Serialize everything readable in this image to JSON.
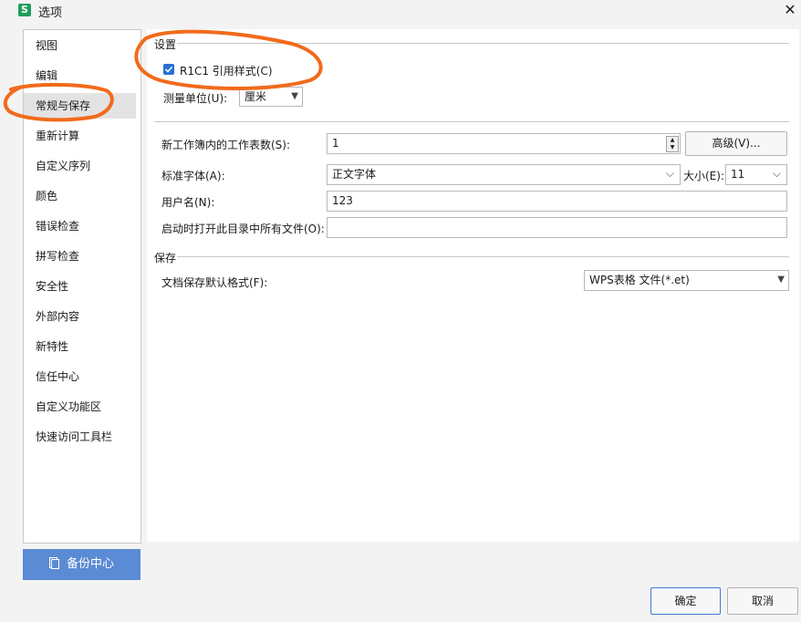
{
  "window": {
    "title": "选项",
    "app_icon_letter": "S"
  },
  "sidebar": {
    "items": [
      {
        "label": "视图"
      },
      {
        "label": "编辑"
      },
      {
        "label": "常规与保存"
      },
      {
        "label": "重新计算"
      },
      {
        "label": "自定义序列"
      },
      {
        "label": "颜色"
      },
      {
        "label": "错误检查"
      },
      {
        "label": "拼写检查"
      },
      {
        "label": "安全性"
      },
      {
        "label": "外部内容"
      },
      {
        "label": "新特性"
      },
      {
        "label": "信任中心"
      },
      {
        "label": "自定义功能区"
      },
      {
        "label": "快速访问工具栏"
      }
    ],
    "selected_index": 2
  },
  "backup_button": {
    "label": "备份中心"
  },
  "settings": {
    "section_title": "设置",
    "r1c1_checkbox": {
      "label": "R1C1 引用样式(C)",
      "checked": true
    },
    "measure_unit": {
      "label": "测量单位(U):",
      "value": "厘米"
    },
    "sheet_count": {
      "label": "新工作簿内的工作表数(S):",
      "value": "1"
    },
    "advanced_button": "高级(V)...",
    "standard_font": {
      "label": "标准字体(A):",
      "value": "正文字体"
    },
    "font_size": {
      "label": "大小(E):",
      "value": "11"
    },
    "username": {
      "label": "用户名(N):",
      "value": "123"
    },
    "startup_dir": {
      "label": "启动时打开此目录中所有文件(O):",
      "value": ""
    }
  },
  "save": {
    "section_title": "保存",
    "default_format": {
      "label": "文档保存默认格式(F):",
      "value": "WPS表格 文件(*.et)"
    }
  },
  "footer": {
    "ok": "确定",
    "cancel": "取消"
  },
  "colors": {
    "accent": "#2a6fd6",
    "backup_bg": "#5b8bd4",
    "annotation": "#f26a1b",
    "selected_item": "#e3e3e3"
  }
}
